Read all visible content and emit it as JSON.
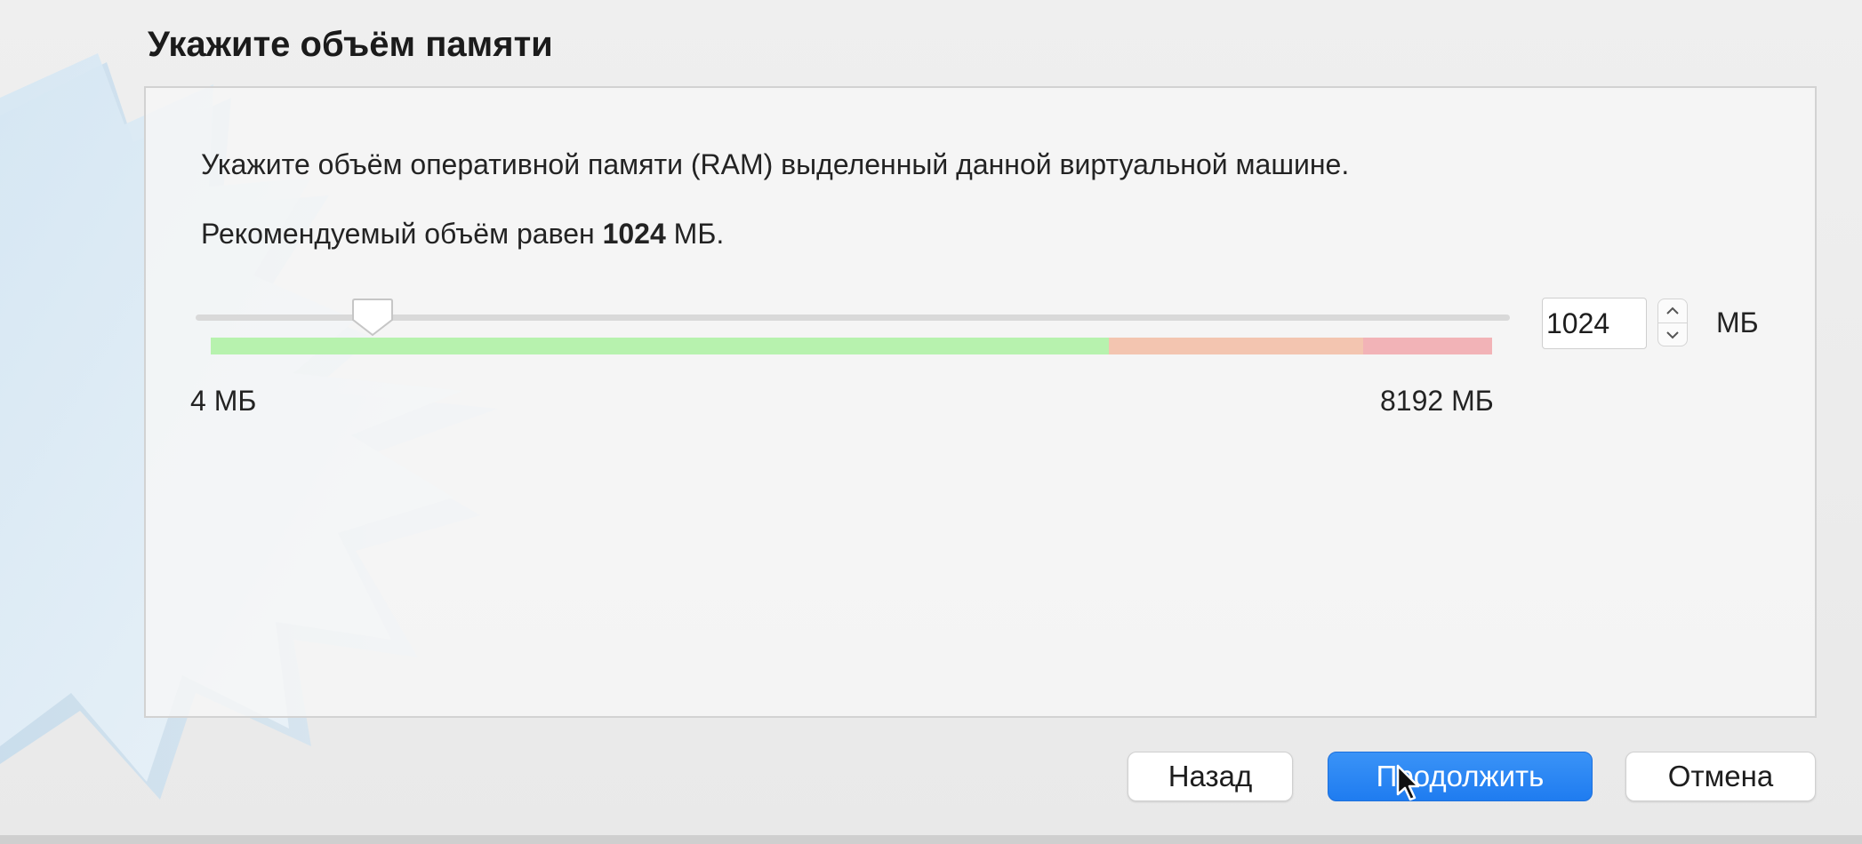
{
  "dialog": {
    "title": "Укажите объём памяти"
  },
  "content": {
    "description": "Укажите объём оперативной памяти (RAM) выделенный данной виртуальной машине.",
    "recommended_prefix": "Рекомендуемый объём равен ",
    "recommended_value": "1024",
    "recommended_suffix": " МБ."
  },
  "memory": {
    "value": "1024",
    "unit": "МБ",
    "min_label": "4 МБ",
    "max_label": "8192 МБ",
    "min": 4,
    "max": 8192,
    "current": 1024,
    "zone_colors": {
      "safe": "#b7f2ae",
      "warning": "#f3c5b0",
      "danger": "#f2b3b7"
    }
  },
  "buttons": {
    "back": "Назад",
    "continue": "Продолжить",
    "cancel": "Отмена"
  },
  "colors": {
    "accent": "#1f7cf0",
    "background": "#ececec",
    "panel": "#f7f7f7"
  },
  "icons": {
    "watermark": "virtualbox-starburst-icon",
    "spin_up": "chevron-up-icon",
    "spin_down": "chevron-down-icon",
    "cursor": "mouse-pointer-icon"
  }
}
